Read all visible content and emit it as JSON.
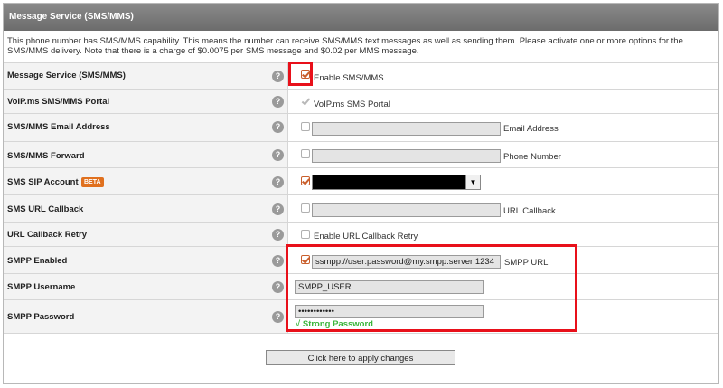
{
  "header": {
    "title": "Message Service (SMS/MMS)"
  },
  "description": "This phone number has SMS/MMS capability. This means the number can receive SMS/MMS text messages as well as sending them. Please activate one or more options for the SMS/MMS delivery. Note that there is a charge of $0.0075 per SMS message and $0.02 per MMS message.",
  "rows": [
    {
      "label": "Message Service (SMS/MMS)",
      "option": "Enable SMS/MMS",
      "checked": true
    },
    {
      "label": "VoIP.ms SMS/MMS Portal",
      "option": "VoIP.ms SMS Portal",
      "checked": true,
      "disabled": true
    },
    {
      "label": "SMS/MMS Email Address",
      "option": "Email Address",
      "value": ""
    },
    {
      "label": "SMS/MMS Forward",
      "option": "Phone Number",
      "value": ""
    },
    {
      "label": "SMS SIP Account",
      "badge": "BETA",
      "checked": true
    },
    {
      "label": "SMS URL Callback",
      "option": "URL Callback",
      "value": ""
    },
    {
      "label": "URL Callback Retry",
      "option": "Enable URL Callback Retry"
    },
    {
      "label": "SMPP Enabled",
      "option": "SMPP URL",
      "value": "ssmpp://user:password@my.smpp.server:1234",
      "checked": true
    },
    {
      "label": "SMPP Username",
      "value": "SMPP_USER"
    },
    {
      "label": "SMPP Password",
      "value": "••••••••••••",
      "strength": "√ Strong Password"
    }
  ],
  "help_glyph": "?",
  "apply_button": "Click here to apply changes",
  "colors": {
    "accent": "#c95f2c",
    "highlight": "#e8101a",
    "strong": "#3ab53a",
    "beta": "#e0701e"
  }
}
